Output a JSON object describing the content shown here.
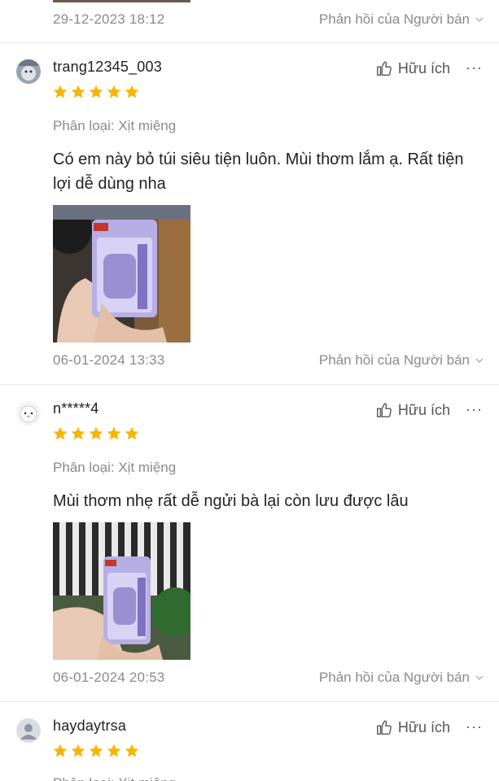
{
  "reply_label": "Phản hồi của Người bán",
  "helpful_label": "Hữu ích",
  "more_label": "···",
  "top_footer": {
    "date": "29-12-2023 18:12"
  },
  "reviews": [
    {
      "username": "trang12345_003",
      "rating": 5,
      "variant": "Phân loại: Xịt miệng",
      "text": "Có em này bỏ túi siêu tiện luôn. Mùi thơm lắm ạ. Rất tiện lợi dễ dùng nha",
      "date": "06-01-2024 13:33"
    },
    {
      "username": "n*****4",
      "rating": 5,
      "variant": "Phân loại: Xịt miệng",
      "text": "Mùi thơm nhẹ rất dễ ngửi bà lại còn lưu được lâu",
      "date": "06-01-2024 20:53"
    },
    {
      "username": "haydaytrsa",
      "rating": 5,
      "variant": "Phân loại: Xịt miệng"
    }
  ],
  "colors": {
    "star": "#f7b500",
    "muted": "#8a8a8a",
    "divider": "#e6e6e6"
  }
}
